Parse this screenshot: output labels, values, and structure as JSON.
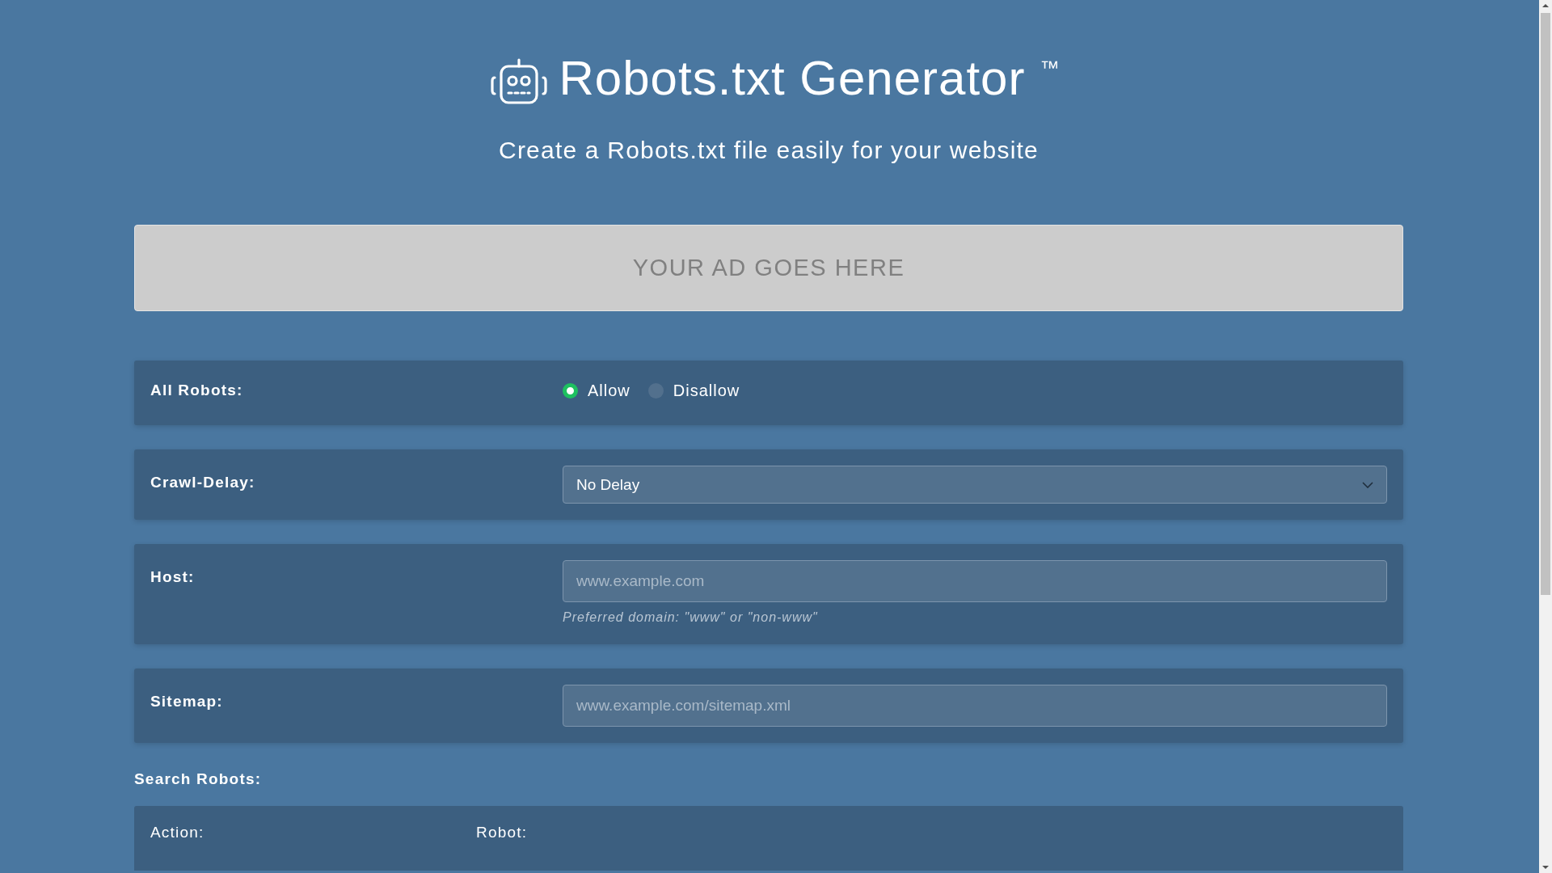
{
  "header": {
    "title": "Robots.txt Generator",
    "trademark": "™",
    "subtitle": "Create a Robots.txt file easily for your website"
  },
  "ad": {
    "text": "YOUR AD GOES HERE"
  },
  "fields": [
    {
      "kind": "radio",
      "label": "All Robots:",
      "options": [
        {
          "label": "Allow",
          "selected": true
        },
        {
          "label": "Disallow",
          "selected": false
        }
      ]
    },
    {
      "kind": "select",
      "label": "Crawl-Delay:",
      "value": "No Delay"
    },
    {
      "kind": "text",
      "label": "Host:",
      "placeholder": "www.example.com",
      "hint": "Preferred domain: \"www\" or \"non-www\""
    },
    {
      "kind": "text",
      "label": "Sitemap:",
      "placeholder": "www.example.com/sitemap.xml"
    }
  ],
  "search_robots": {
    "title": "Search Robots:",
    "columns": [
      "Action:",
      "Robot:"
    ]
  }
}
